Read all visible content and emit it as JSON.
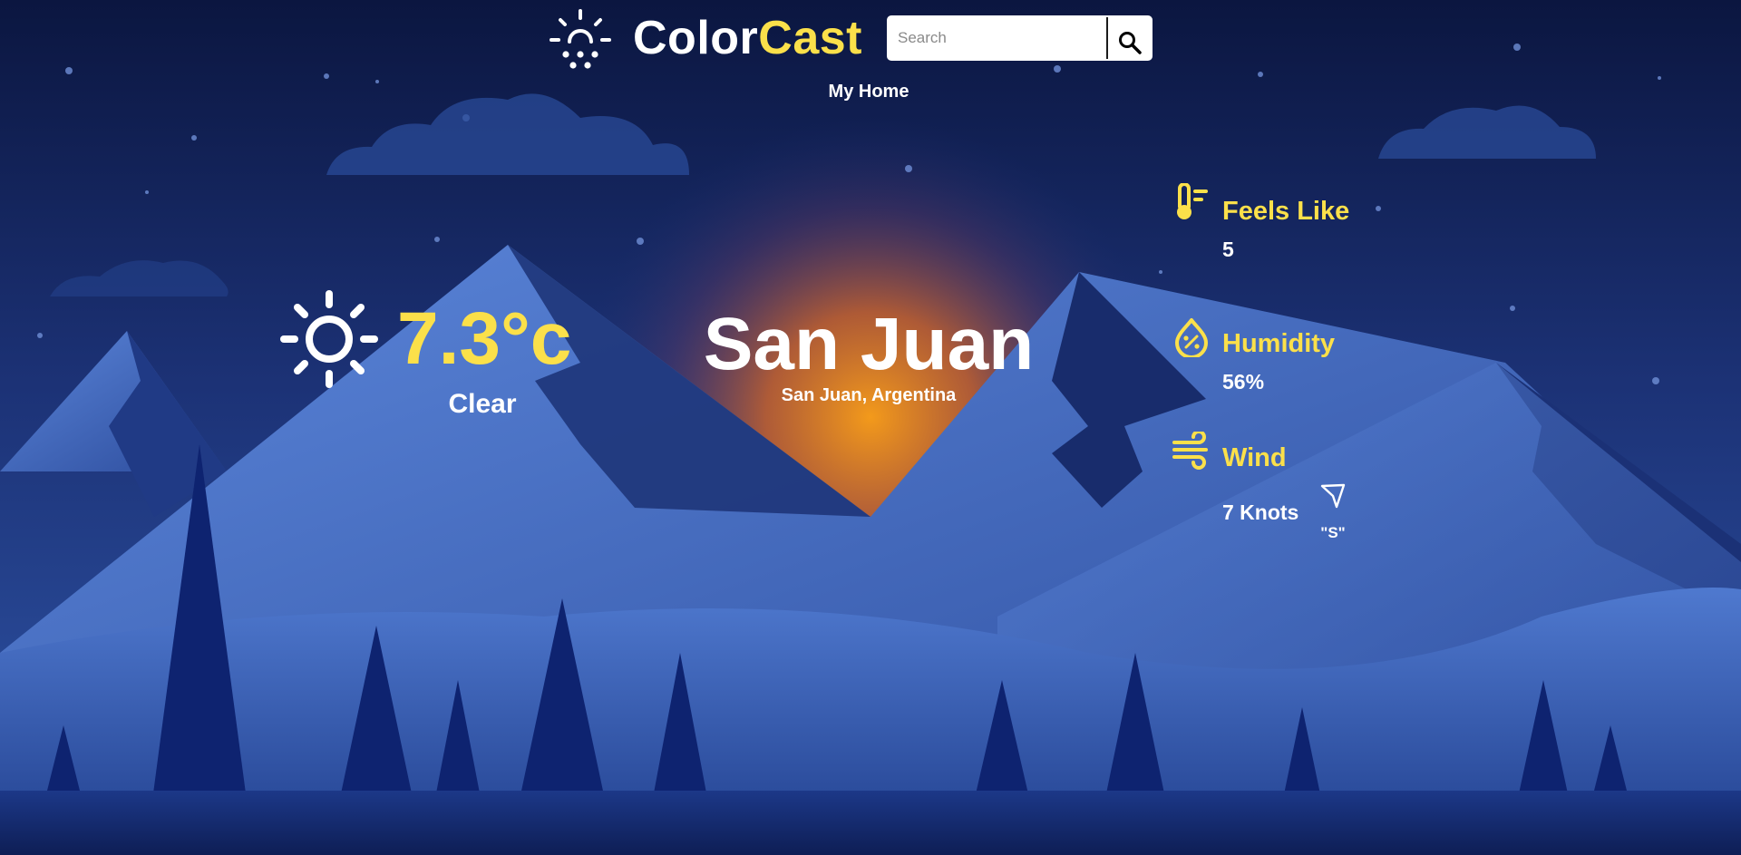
{
  "header": {
    "brand_part_a": "Color",
    "brand_part_b": "Cast",
    "logo_icon": "sun-cloud-rain-icon",
    "search": {
      "placeholder": "Search",
      "value": "",
      "button_icon": "search-icon"
    },
    "home_link": "My Home"
  },
  "current": {
    "icon": "sun-icon",
    "temperature": "7.3°c",
    "condition": "Clear"
  },
  "city": {
    "name": "San Juan",
    "location": "San Juan, Argentina"
  },
  "details": {
    "feels_like": {
      "icon": "thermometer-icon",
      "label": "Feels Like",
      "value": "5"
    },
    "humidity": {
      "icon": "humidity-drop-icon",
      "label": "Humidity",
      "value": "56%"
    },
    "wind": {
      "icon": "wind-icon",
      "label": "Wind",
      "value": "7 Knots",
      "direction_icon": "navigation-arrow-icon",
      "direction": "\"S\""
    }
  },
  "colors": {
    "accent": "#fbe04a",
    "text": "#ffffff",
    "sky_top": "#0b1640",
    "glow": "#f0961e",
    "mountain": "#3a5fb8"
  }
}
